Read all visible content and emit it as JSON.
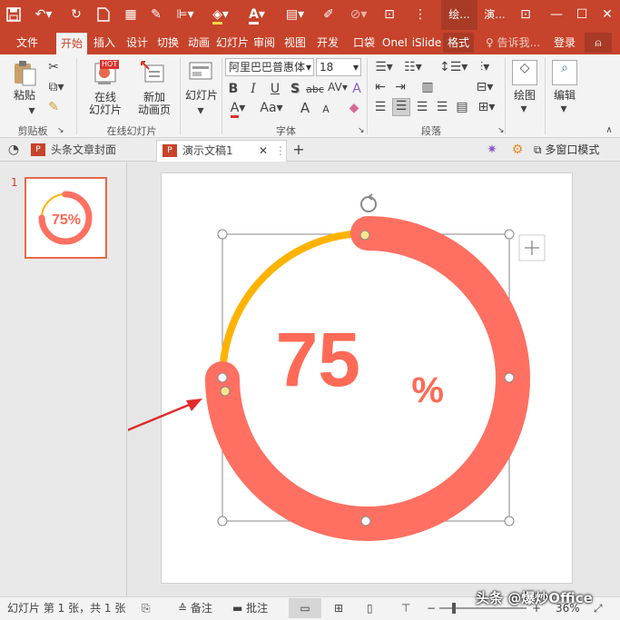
{
  "quick_access": {
    "save_icon": "save-icon",
    "undo_icon": "undo-icon",
    "redo_icon": "repeat-icon",
    "new_icon": "new-doc-icon",
    "window_title_left": "绘...",
    "window_title_right": "演..."
  },
  "tabs": [
    "文件",
    "开始",
    "插入",
    "设计",
    "切换",
    "动画",
    "幻灯片",
    "审阅",
    "视图",
    "开发",
    "口袋",
    "OneI",
    "iSlide",
    "格式"
  ],
  "active_tab": "开始",
  "tell_me": "告诉我...",
  "login": "登录",
  "ribbon": {
    "paste_label": "粘贴",
    "clipboard_group": "剪贴板",
    "online_slides_label": "在线\n幻灯片",
    "hot_badge": "HOT",
    "new_anim_label": "新加\n动画页",
    "online_group": "在线幻灯片",
    "slides_label": "幻灯片",
    "font_name": "阿里巴巴普惠体",
    "font_size": "18",
    "font_group": "字体",
    "paragraph_group": "段落",
    "draw_label": "绘图",
    "edit_label": "编辑",
    "bold": "B",
    "italic": "I",
    "underline": "U",
    "shadow": "S",
    "strike": "abc",
    "spacing": "AV",
    "clear": "A",
    "aa": "Aa",
    "grow": "A",
    "shrink": "A"
  },
  "doc_tabs": [
    {
      "label": "头条文章封面",
      "active": false
    },
    {
      "label": "演示文稿1",
      "active": true
    }
  ],
  "multi_window": "多窗口模式",
  "thumbnail": {
    "number": "1",
    "value_text": "75%"
  },
  "slide": {
    "big_number": "75",
    "percent_sign": "%",
    "progress": 0.75,
    "colors": {
      "track": "#ff7062",
      "accent": "#ffb300",
      "text": "#ff6a56"
    }
  },
  "status": {
    "slide_info": "幻灯片 第 1 张，共 1 张",
    "notes": "备注",
    "comments": "批注",
    "zoom": "36%",
    "watermark": "头条 @爆炒Office"
  }
}
